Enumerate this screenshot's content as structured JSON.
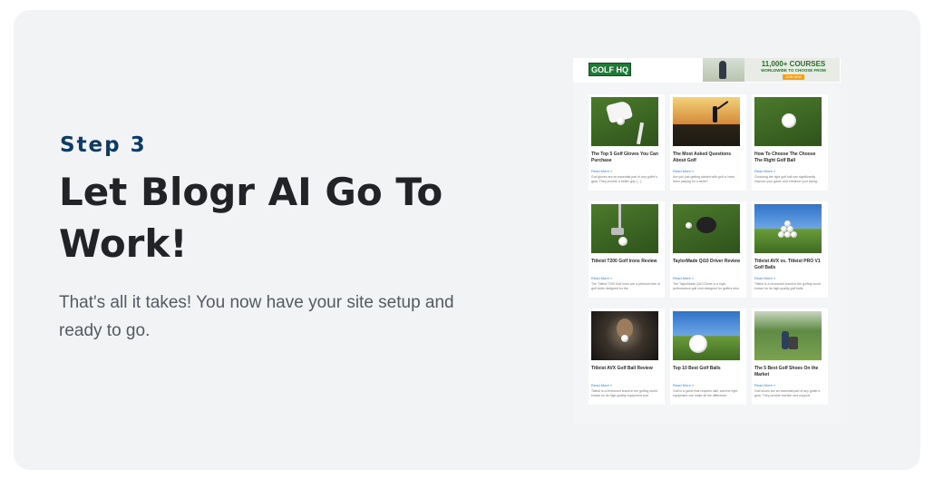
{
  "hero": {
    "step_label": "Step 3",
    "heading": "Let Blogr AI Go To Work!",
    "description": "That's all it takes! You now have your site setup and ready to go."
  },
  "preview": {
    "logo_text": "GOLF HQ",
    "banner": {
      "title": "11,000+ COURSES",
      "subtitle": "WORLDWIDE TO CHOOSE FROM",
      "button": "JOIN NOW"
    },
    "posts": [
      {
        "title": "The Top 5 Golf Gloves You Can Purchase",
        "read_more": "Read More »",
        "excerpt": "Golf gloves are an essential part of any golfer's gear. They provide a better grip, [...]",
        "image_icon": "golf-glove-image"
      },
      {
        "title": "The Most Asked Questions About Golf",
        "read_more": "Read More »",
        "excerpt": "Are you just getting started with golf or have been playing for a while?",
        "image_icon": "golfer-sunset-image"
      },
      {
        "title": "How To Choose The Choose The Right Golf Ball",
        "read_more": "Read More »",
        "excerpt": "Choosing the right golf ball can significantly improve your game and enhance your swing.",
        "image_icon": "golf-ball-image"
      },
      {
        "title": "Titleist T200 Golf Irons Review",
        "read_more": "Read More »",
        "excerpt": "The Titleist T200 Golf Irons are a premium line of golf clubs designed for the",
        "image_icon": "golf-club-image"
      },
      {
        "title": "TaylorMade Qi10 Driver Review",
        "read_more": "Read More »",
        "excerpt": "The TaylorMade Qi10 Driver is a high-performance golf club designed for golfers who",
        "image_icon": "golf-driver-image"
      },
      {
        "title": "Titleist AVX vs. Titleist PRO V1 Golf Balls",
        "read_more": "Read More »",
        "excerpt": "Titleist is a renowned brand in the golfing world known for its high-quality golf balls.",
        "image_icon": "golf-balls-pyramid-image"
      },
      {
        "title": "Titleist AVX Golf Ball Review",
        "read_more": "Read More »",
        "excerpt": "Titleist is a renowned brand in the golfing world known for its high-quality equipment and",
        "image_icon": "golfer-holding-ball-image"
      },
      {
        "title": "Top 10 Best Golf Balls",
        "read_more": "Read More »",
        "excerpt": "Golf is a game that requires skill, and the right equipment can make all the difference.",
        "image_icon": "golf-ball-course-image"
      },
      {
        "title": "The 5 Best Golf Shoes On the Market",
        "read_more": "Read More »",
        "excerpt": "Golf shoes are an essential part of any golfer's gear. They provide traction and support",
        "image_icon": "golfer-walking-image"
      }
    ]
  }
}
